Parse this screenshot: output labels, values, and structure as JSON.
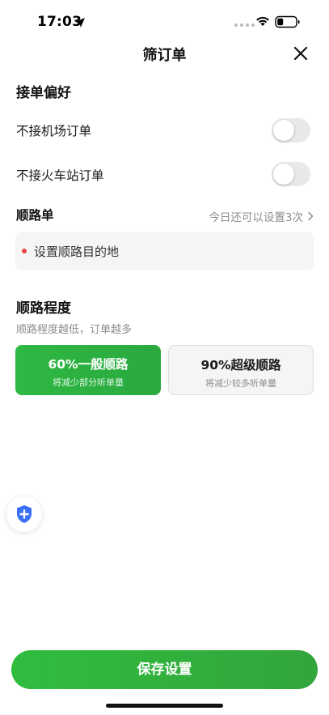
{
  "status_bar": {
    "time": "17:03",
    "icons": [
      "location-arrow-icon",
      "signal-dots-icon",
      "wifi-icon",
      "battery-icon"
    ]
  },
  "nav": {
    "title": "筛订单",
    "close_icon": "close-icon"
  },
  "preferences": {
    "title": "接单偏好",
    "items": [
      {
        "label": "不接机场订单",
        "enabled": false
      },
      {
        "label": "不接火车站订单",
        "enabled": false
      }
    ]
  },
  "route_order": {
    "title": "顺路单",
    "hint": "今日还可以设置3次",
    "destination_placeholder": "设置顺路目的地"
  },
  "route_degree": {
    "title": "顺路程度",
    "description": "顺路程度越低，订单越多",
    "options": [
      {
        "title": "60%一般顺路",
        "subtitle": "将减少部分听单量",
        "selected": true
      },
      {
        "title": "90%超级顺路",
        "subtitle": "将减少较多听单量",
        "selected": false
      }
    ]
  },
  "safety": {
    "icon": "shield-plus-icon"
  },
  "footer": {
    "save_label": "保存设置"
  },
  "colors": {
    "accent_green": "#2fb843",
    "dot_red": "#e84545",
    "safety_blue": "#3a6ff7",
    "muted_text": "#8c8c8c"
  }
}
